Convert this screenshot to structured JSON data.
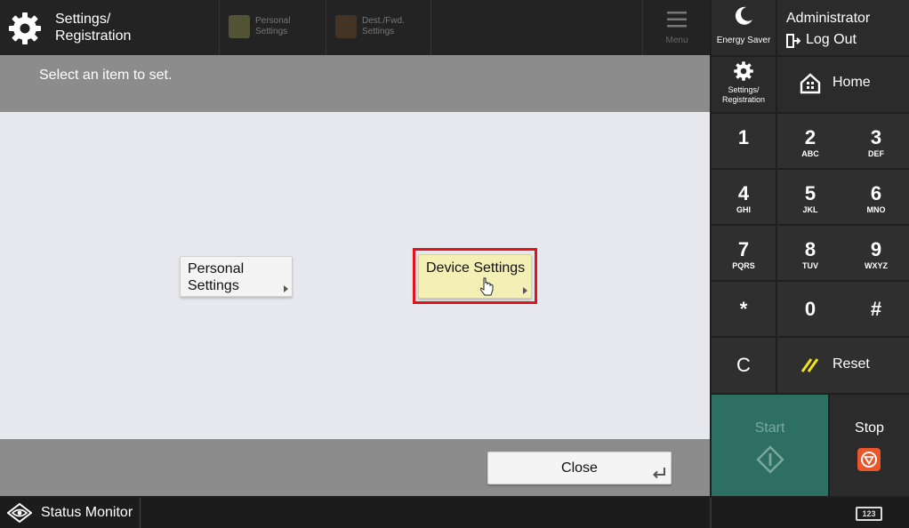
{
  "header": {
    "title_line1": "Settings/",
    "title_line2": "Registration",
    "tabs": [
      {
        "label_line1": "Personal",
        "label_line2": "Settings"
      },
      {
        "label_line1": "Dest./Fwd.",
        "label_line2": "Settings"
      }
    ],
    "menu_label": "Menu"
  },
  "side": {
    "energy_saver": "Energy Saver",
    "user": "Administrator",
    "logout": "Log Out",
    "settings_line1": "Settings/",
    "settings_line2": "Registration",
    "home": "Home"
  },
  "keypad": [
    {
      "num": "1",
      "sub": ""
    },
    {
      "num": "2",
      "sub": "ABC"
    },
    {
      "num": "3",
      "sub": "DEF"
    },
    {
      "num": "4",
      "sub": "GHI"
    },
    {
      "num": "5",
      "sub": "JKL"
    },
    {
      "num": "6",
      "sub": "MNO"
    },
    {
      "num": "7",
      "sub": "PQRS"
    },
    {
      "num": "8",
      "sub": "TUV"
    },
    {
      "num": "9",
      "sub": "WXYZ"
    },
    {
      "num": "*",
      "sub": ""
    },
    {
      "num": "0",
      "sub": ""
    },
    {
      "num": "#",
      "sub": ""
    }
  ],
  "keys": {
    "clear": "C",
    "reset": "Reset",
    "start": "Start",
    "stop": "Stop"
  },
  "main": {
    "instruction": "Select an item to set.",
    "options": [
      {
        "label_line1": "Personal",
        "label_line2": "Settings"
      },
      {
        "label": "Device Settings"
      }
    ],
    "close": "Close"
  },
  "status": {
    "monitor": "Status Monitor",
    "numpad": "123"
  },
  "colors": {
    "start": "#2e6f63",
    "highlight_box": "#e3121b",
    "selected_button": "#f4f0b5",
    "stop_icon": "#e8562a"
  }
}
